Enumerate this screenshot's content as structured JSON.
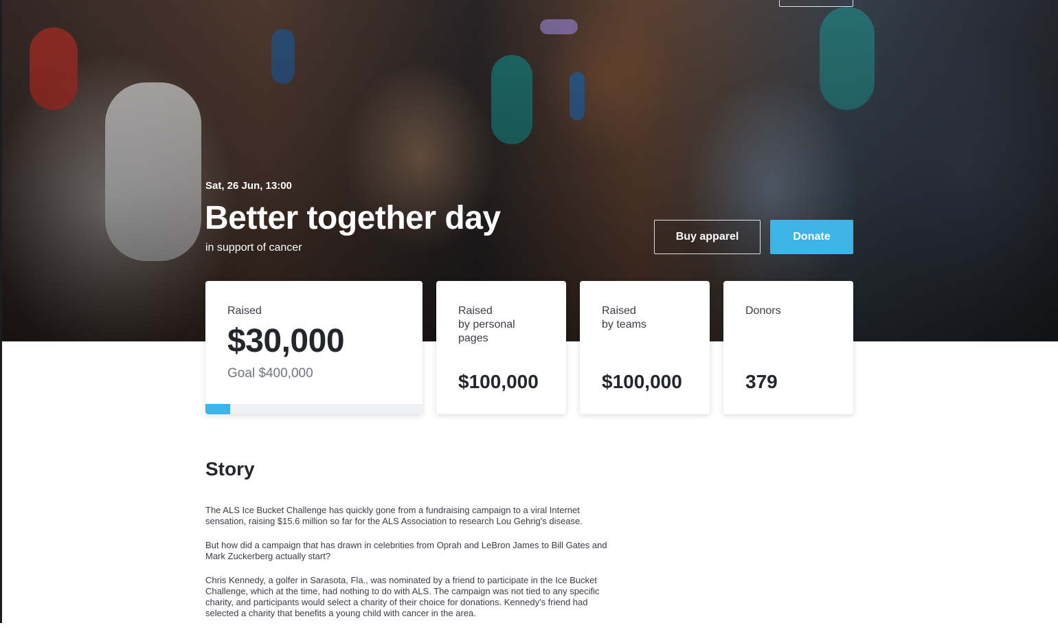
{
  "hero": {
    "date": "Sat, 26 Jun, 13:00",
    "title": "Better together day",
    "subtitle": "in support of cancer",
    "buy_apparel_label": "Buy apparel",
    "donate_label": "Donate"
  },
  "stats": {
    "raised": {
      "label": "Raised",
      "amount": "$30,000",
      "goal": "Goal $400,000",
      "progress_percent": 7.5
    },
    "personal": {
      "label_line1": "Raised",
      "label_line2": "by personal",
      "label_line3": "pages",
      "amount": "$100,000"
    },
    "teams": {
      "label_line1": "Raised",
      "label_line2": "by teams",
      "amount": "$100,000"
    },
    "donors": {
      "label": "Donors",
      "count": "379"
    }
  },
  "story": {
    "title": "Story",
    "paragraphs": [
      "The ALS Ice Bucket Challenge has quickly gone from a fundraising campaign to a viral Internet sensation, raising $15.6 million so far for the ALS Association to research Lou Gehrig's disease.",
      "But how did a campaign that has drawn in celebrities from Oprah and LeBron James to Bill Gates and Mark Zuckerberg actually start?",
      "Chris Kennedy, a golfer in Sarasota, Fla., was nominated by a friend to participate in the Ice Bucket Challenge, which at the time, had nothing to do with ALS. The campaign was not tied to any specific charity, and participants would select a charity of their choice for donations. Kennedy's friend had selected a charity that benefits a young child with cancer in the area."
    ]
  },
  "colors": {
    "accent": "#3cb4e5",
    "text_dark": "#24262d",
    "goal_text": "#6f7480"
  }
}
